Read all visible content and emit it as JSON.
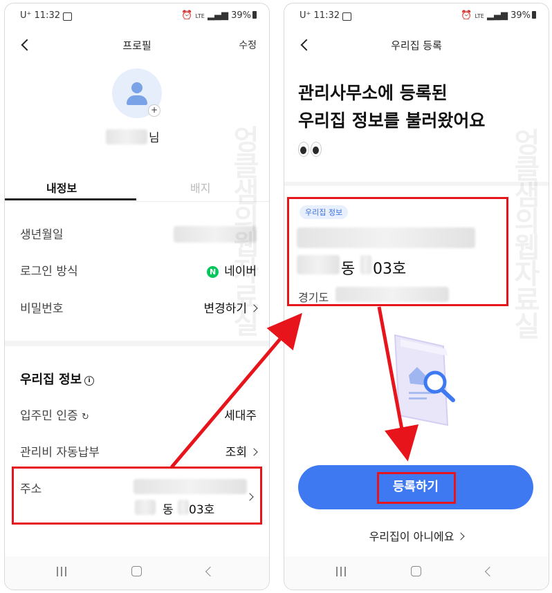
{
  "left": {
    "status": {
      "time": "11:32",
      "carrier": "U⁺",
      "signal": "LTE",
      "battery": "39%"
    },
    "nav": {
      "title": "프로필",
      "edit": "수정"
    },
    "profile": {
      "name_suffix": "님",
      "plus": "+"
    },
    "tabs": [
      {
        "label": "내정보"
      },
      {
        "label": "배지"
      }
    ],
    "rows": [
      {
        "label": "생년월일",
        "value": ""
      },
      {
        "label": "로그인 방식",
        "value": "네이버",
        "icon": "naver-icon"
      },
      {
        "label": "비밀번호",
        "value": "변경하기"
      }
    ],
    "section": {
      "title": "우리집 정보",
      "info_icon": "i"
    },
    "home_rows": [
      {
        "label": "입주민 인증",
        "value": "세대주"
      },
      {
        "label": "관리비 자동납부",
        "value": "조회"
      }
    ],
    "address": {
      "label": "주소",
      "unit_dong": "동",
      "unit_ho": "03호"
    },
    "naver_letter": "N"
  },
  "right": {
    "status": {
      "time": "11:32",
      "carrier": "U⁺",
      "signal": "LTE",
      "battery": "39%"
    },
    "nav": {
      "title": "우리집 등록"
    },
    "heading": {
      "line1": "관리사무소에 등록된",
      "line2": "우리집 정보를 불러왔어요"
    },
    "card": {
      "chip": "우리집 정보",
      "dong": "동",
      "ho": "03호",
      "region": "경기도"
    },
    "cta": "등록하기",
    "not_mine": "우리집이 아니에요"
  },
  "watermark": {
    "text": "엉클샘의웹자료실"
  },
  "colors": {
    "accent": "#3e79f2",
    "annotation_red": "#e8141b",
    "naver_green": "#03c75a"
  }
}
